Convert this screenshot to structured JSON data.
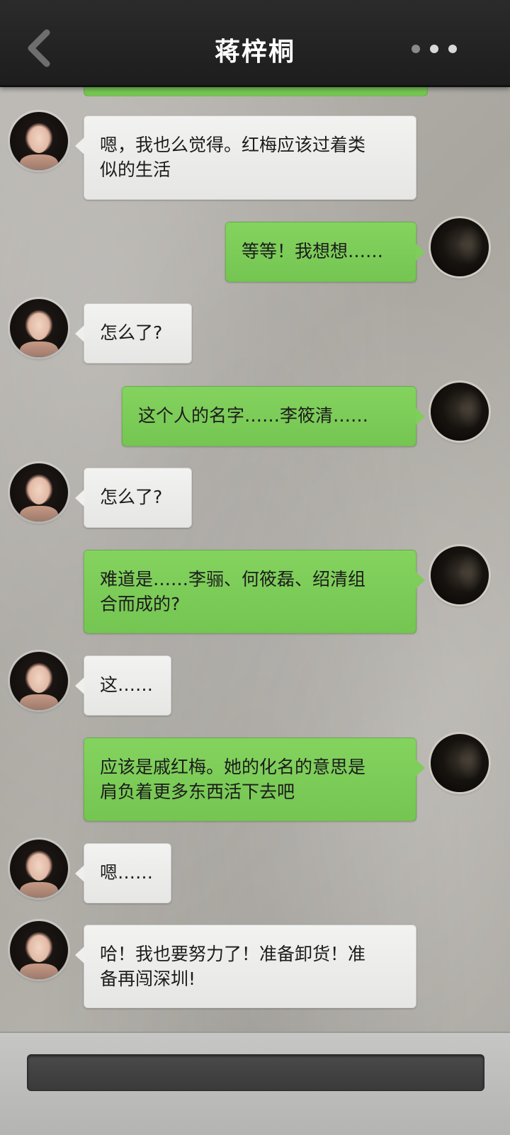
{
  "header": {
    "title": "蒋梓桐",
    "back_icon": "chevron-left-icon",
    "more_icon": "more-dots-icon"
  },
  "colors": {
    "header_bg": "#222222",
    "bubble_out": "#7fcd5a",
    "bubble_in": "#efefed",
    "more_dot": "#d0d0d0"
  },
  "messages": [
    {
      "side": "in",
      "lines": [
        "嗯，我也么觉得。红梅应该过着类",
        "似的生活"
      ]
    },
    {
      "side": "out",
      "lines": [
        "等等！我想想……"
      ]
    },
    {
      "side": "in",
      "lines": [
        "怎么了?"
      ]
    },
    {
      "side": "out",
      "lines": [
        "这个人的名字……李筱清……"
      ]
    },
    {
      "side": "in",
      "lines": [
        "怎么了?"
      ]
    },
    {
      "side": "out",
      "lines": [
        "难道是……李骊、何筱磊、绍清组",
        "合而成的?"
      ]
    },
    {
      "side": "in",
      "lines": [
        "这……"
      ]
    },
    {
      "side": "out",
      "lines": [
        "应该是戚红梅。她的化名的意思是",
        "肩负着更多东西活下去吧"
      ]
    },
    {
      "side": "in",
      "lines": [
        "嗯……"
      ]
    },
    {
      "side": "in",
      "lines": [
        "哈！我也要努力了！准备卸货！准",
        "备再闯深圳!"
      ]
    }
  ],
  "footer": {
    "input_value": "",
    "input_placeholder": ""
  }
}
